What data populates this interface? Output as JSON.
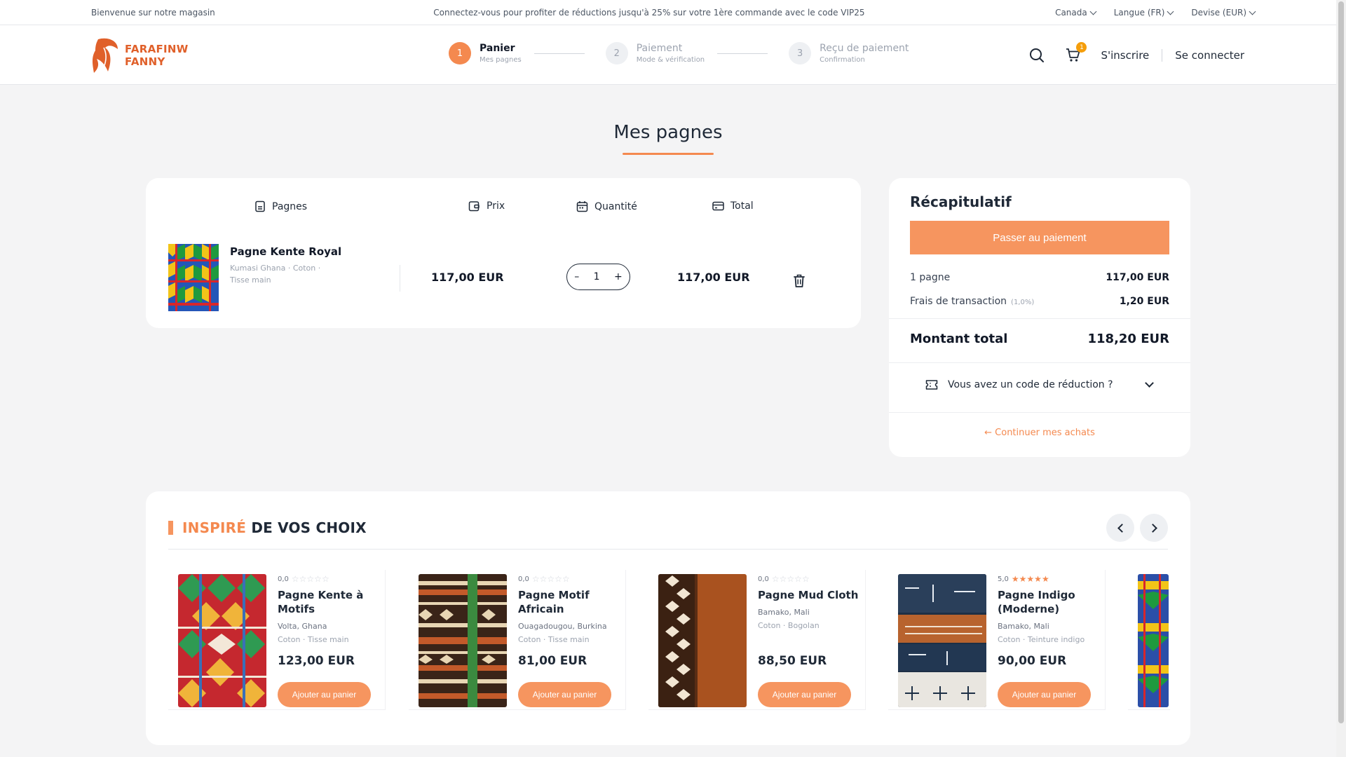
{
  "topbar": {
    "welcome": "Bienvenue sur notre magasin",
    "promo": "Connectez-vous pour profiter de réductions jusqu'à 25% sur votre 1ère commande avec le code VIP25",
    "country": "Canada",
    "language": "Langue (FR)",
    "currency": "Devise (EUR)"
  },
  "brand": {
    "line1": "FARAFINW",
    "line2": "FANNY",
    "color": "#e0602a"
  },
  "steps": [
    {
      "num": "1",
      "title": "Panier",
      "sub": "Mes pagnes"
    },
    {
      "num": "2",
      "title": "Paiement",
      "sub": "Mode & vérification"
    },
    {
      "num": "3",
      "title": "Reçu de paiement",
      "sub": "Confirmation"
    }
  ],
  "header": {
    "cart_count": "1",
    "signup": "S'inscrire",
    "login": "Se connecter"
  },
  "page_title": "Mes pagnes",
  "cart": {
    "headers": {
      "product": "Pagnes",
      "price": "Prix",
      "quantity": "Quantité",
      "total": "Total"
    },
    "item": {
      "name": "Pagne Kente Royal",
      "meta": "Kumasi Ghana · Coton · Tisse main",
      "price": "117,00 EUR",
      "qty": "1",
      "minus": "–",
      "plus": "+",
      "total": "117,00 EUR"
    }
  },
  "summary": {
    "title": "Récapitulatif",
    "pay_button": "Passer au paiement",
    "count_label": "1 pagne",
    "count_value": "117,00 EUR",
    "fee_label": "Frais de transaction",
    "fee_pct": "(1,0%)",
    "fee_value": "1,20 EUR",
    "total_label": "Montant total",
    "total_value": "118,20 EUR",
    "promo_label": "Vous avez un code de réduction ?",
    "continue": "← Continuer mes achats"
  },
  "inspired": {
    "title_accent": "INSPIRÉ",
    "title_rest": "DE VOS CHOIX",
    "products": [
      {
        "rating": "0,0",
        "stars": 0,
        "name": "Pagne Kente à Motifs",
        "location": "Volta, Ghana",
        "material": "Coton · Tisse main",
        "price": "123,00 EUR",
        "button": "Ajouter au panier"
      },
      {
        "rating": "0,0",
        "stars": 0,
        "name": "Pagne Motif Africain",
        "location": "Ouagadougou, Burkina",
        "material": "Coton · Tisse main",
        "price": "81,00 EUR",
        "button": "Ajouter au panier"
      },
      {
        "rating": "0,0",
        "stars": 0,
        "name": "Pagne Mud Cloth",
        "location": "Bamako, Mali",
        "material": "Coton · Bogolan",
        "price": "88,50 EUR",
        "button": "Ajouter au panier"
      },
      {
        "rating": "5,0",
        "stars": 5,
        "name": "Pagne Indigo (Moderne)",
        "location": "Bamako, Mali",
        "material": "Coton · Teinture indigo",
        "price": "90,00 EUR",
        "button": "Ajouter au panier"
      }
    ]
  },
  "colors": {
    "accent": "#f4894f",
    "button": "#f6955f"
  }
}
